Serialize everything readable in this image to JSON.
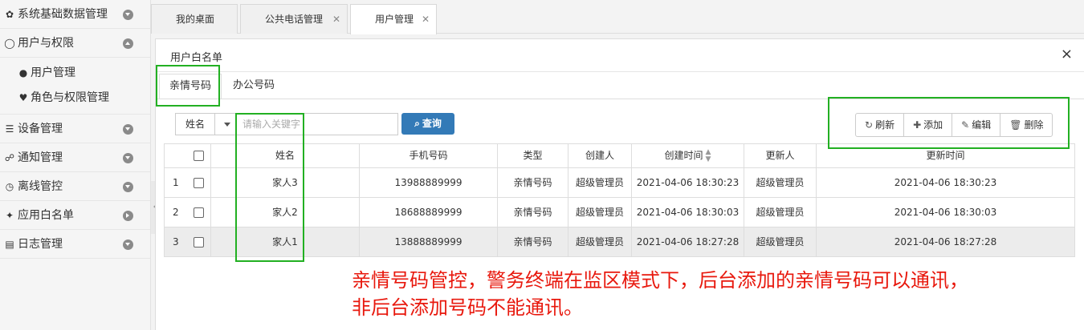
{
  "sidebar": {
    "items": [
      {
        "icon": "gear-icon",
        "glyph": "✿",
        "label": "系统基础数据管理",
        "toggle": "down"
      },
      {
        "icon": "circle-notch-icon",
        "glyph": "◯",
        "label": "用户与权限",
        "toggle": "up"
      },
      {
        "icon": "list-icon",
        "glyph": "☰",
        "label": "设备管理",
        "toggle": "down"
      },
      {
        "icon": "comments-icon",
        "glyph": "☍",
        "label": "通知管理",
        "toggle": "down"
      },
      {
        "icon": "clock-icon",
        "glyph": "◷",
        "label": "离线管控",
        "toggle": "down"
      },
      {
        "icon": "android-icon",
        "glyph": "✦",
        "label": "应用白名单",
        "toggle": "right"
      },
      {
        "icon": "file-icon",
        "glyph": "▤",
        "label": "日志管理",
        "toggle": "down"
      }
    ],
    "subitems": [
      {
        "icon": "user-icon",
        "glyph": "●",
        "label": "用户管理"
      },
      {
        "icon": "heart-icon",
        "glyph": "♥",
        "label": "角色与权限管理"
      }
    ]
  },
  "tabs": [
    {
      "label": "我的桌面",
      "closable": false
    },
    {
      "label": "公共电话管理",
      "closable": true
    },
    {
      "label": "用户管理",
      "closable": true,
      "active": true
    }
  ],
  "panel": {
    "title": "用户白名单",
    "close": "×",
    "inner_tabs": [
      "亲情号码",
      "办公号码"
    ]
  },
  "search": {
    "field": "姓名",
    "placeholder": "请输入关键字",
    "button": "查询"
  },
  "toolbar": {
    "refresh": "刷新",
    "add": "添加",
    "edit": "编辑",
    "delete": "删除"
  },
  "table": {
    "columns": [
      "姓名",
      "手机号码",
      "类型",
      "创建人",
      "创建时间",
      "更新人",
      "更新时间"
    ],
    "rows": [
      {
        "idx": "1",
        "name": "家人3",
        "phone": "13988889999",
        "type": "亲情号码",
        "creator": "超级管理员",
        "ctime": "2021-04-06 18:30:23",
        "updater": "超级管理员",
        "utime": "2021-04-06 18:30:23"
      },
      {
        "idx": "2",
        "name": "家人2",
        "phone": "18688889999",
        "type": "亲情号码",
        "creator": "超级管理员",
        "ctime": "2021-04-06 18:30:03",
        "updater": "超级管理员",
        "utime": "2021-04-06 18:30:03"
      },
      {
        "idx": "3",
        "name": "家人1",
        "phone": "13888889999",
        "type": "亲情号码",
        "creator": "超级管理员",
        "ctime": "2021-04-06 18:27:28",
        "updater": "超级管理员",
        "utime": "2021-04-06 18:27:28"
      }
    ]
  },
  "annotation": {
    "line1": "亲情号码管控，警务终端在监区模式下，后台添加的亲情号码可以通讯，",
    "line2": "非后台添加号码不能通讯。",
    "color": "#e8180d",
    "box_color": "#22b022"
  }
}
